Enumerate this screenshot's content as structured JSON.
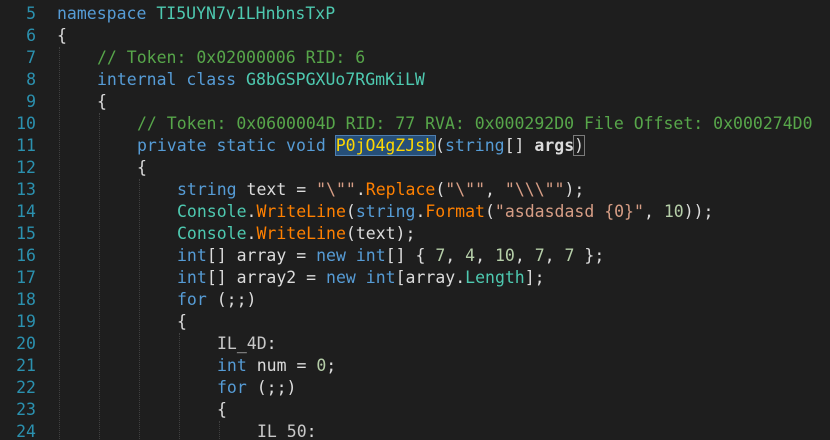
{
  "editor": {
    "lines": [
      {
        "n": "5",
        "indent": 0,
        "tokens": [
          {
            "t": "namespace ",
            "c": "kw"
          },
          {
            "t": "TI5UYN7v1LHnbnsTxP",
            "c": "ty"
          }
        ]
      },
      {
        "n": "6",
        "indent": 0,
        "tokens": [
          {
            "t": "{",
            "c": "ident"
          }
        ]
      },
      {
        "n": "7",
        "indent": 1,
        "tokens": [
          {
            "t": "// Token: 0x02000006 RID: 6",
            "c": "cm"
          }
        ]
      },
      {
        "n": "8",
        "indent": 1,
        "tokens": [
          {
            "t": "internal ",
            "c": "kw"
          },
          {
            "t": "class ",
            "c": "kw"
          },
          {
            "t": "G8bGSPGXUo7RGmKiLW",
            "c": "ty"
          }
        ]
      },
      {
        "n": "9",
        "indent": 1,
        "tokens": [
          {
            "t": "{",
            "c": "ident"
          }
        ]
      },
      {
        "n": "10",
        "indent": 2,
        "tokens": [
          {
            "t": "// Token: 0x0600004D RID: 77 RVA: 0x000292D0 File Offset: 0x000274D0",
            "c": "cm"
          }
        ]
      },
      {
        "n": "11",
        "indent": 2,
        "tokens": [
          {
            "t": "private ",
            "c": "kw"
          },
          {
            "t": "static ",
            "c": "kw"
          },
          {
            "t": "void ",
            "c": "kw"
          },
          {
            "t": "P0jO4gZJsb",
            "c": "hl"
          },
          {
            "t": "(",
            "c": "ident"
          },
          {
            "t": "string",
            "c": "kw"
          },
          {
            "t": "[] ",
            "c": "ident"
          },
          {
            "t": "args",
            "c": "prm"
          },
          {
            "t": ")",
            "c": "braceHL"
          }
        ]
      },
      {
        "n": "12",
        "indent": 2,
        "tokens": [
          {
            "t": "{",
            "c": "ident"
          }
        ]
      },
      {
        "n": "13",
        "indent": 3,
        "tokens": [
          {
            "t": "string ",
            "c": "kw"
          },
          {
            "t": "text = ",
            "c": "ident"
          },
          {
            "t": "\"\\\"\"",
            "c": "str"
          },
          {
            "t": ".",
            "c": "ident"
          },
          {
            "t": "Replace",
            "c": "mth"
          },
          {
            "t": "(",
            "c": "ident"
          },
          {
            "t": "\"\\\"\"",
            "c": "str"
          },
          {
            "t": ", ",
            "c": "ident"
          },
          {
            "t": "\"\\\\\\\"\"",
            "c": "str"
          },
          {
            "t": ");",
            "c": "ident"
          }
        ]
      },
      {
        "n": "14",
        "indent": 3,
        "tokens": [
          {
            "t": "Console",
            "c": "ty"
          },
          {
            "t": ".",
            "c": "ident"
          },
          {
            "t": "WriteLine",
            "c": "mth"
          },
          {
            "t": "(",
            "c": "ident"
          },
          {
            "t": "string",
            "c": "kw"
          },
          {
            "t": ".",
            "c": "ident"
          },
          {
            "t": "Format",
            "c": "mth"
          },
          {
            "t": "(",
            "c": "ident"
          },
          {
            "t": "\"asdasdasd {0}\"",
            "c": "str"
          },
          {
            "t": ", ",
            "c": "ident"
          },
          {
            "t": "10",
            "c": "num"
          },
          {
            "t": "));",
            "c": "ident"
          }
        ]
      },
      {
        "n": "15",
        "indent": 3,
        "tokens": [
          {
            "t": "Console",
            "c": "ty"
          },
          {
            "t": ".",
            "c": "ident"
          },
          {
            "t": "WriteLine",
            "c": "mth"
          },
          {
            "t": "(text);",
            "c": "ident"
          }
        ]
      },
      {
        "n": "16",
        "indent": 3,
        "tokens": [
          {
            "t": "int",
            "c": "kw"
          },
          {
            "t": "[] array = ",
            "c": "ident"
          },
          {
            "t": "new ",
            "c": "kw"
          },
          {
            "t": "int",
            "c": "kw"
          },
          {
            "t": "[] { ",
            "c": "ident"
          },
          {
            "t": "7",
            "c": "num"
          },
          {
            "t": ", ",
            "c": "ident"
          },
          {
            "t": "4",
            "c": "num"
          },
          {
            "t": ", ",
            "c": "ident"
          },
          {
            "t": "10",
            "c": "num"
          },
          {
            "t": ", ",
            "c": "ident"
          },
          {
            "t": "7",
            "c": "num"
          },
          {
            "t": ", ",
            "c": "ident"
          },
          {
            "t": "7",
            "c": "num"
          },
          {
            "t": " };",
            "c": "ident"
          }
        ]
      },
      {
        "n": "17",
        "indent": 3,
        "tokens": [
          {
            "t": "int",
            "c": "kw"
          },
          {
            "t": "[] array2 = ",
            "c": "ident"
          },
          {
            "t": "new ",
            "c": "kw"
          },
          {
            "t": "int",
            "c": "kw"
          },
          {
            "t": "[array.",
            "c": "ident"
          },
          {
            "t": "Length",
            "c": "ty"
          },
          {
            "t": "];",
            "c": "ident"
          }
        ]
      },
      {
        "n": "18",
        "indent": 3,
        "tokens": [
          {
            "t": "for ",
            "c": "kw"
          },
          {
            "t": "(;;)",
            "c": "ident"
          }
        ]
      },
      {
        "n": "19",
        "indent": 3,
        "tokens": [
          {
            "t": "{",
            "c": "ident"
          }
        ]
      },
      {
        "n": "20",
        "indent": 4,
        "tokens": [
          {
            "t": "IL_4D",
            "c": "lbl"
          },
          {
            "t": ":",
            "c": "ident"
          }
        ]
      },
      {
        "n": "21",
        "indent": 4,
        "tokens": [
          {
            "t": "int ",
            "c": "kw"
          },
          {
            "t": "num = ",
            "c": "ident"
          },
          {
            "t": "0",
            "c": "num"
          },
          {
            "t": ";",
            "c": "ident"
          }
        ]
      },
      {
        "n": "22",
        "indent": 4,
        "tokens": [
          {
            "t": "for ",
            "c": "kw"
          },
          {
            "t": "(;;)",
            "c": "ident"
          }
        ]
      },
      {
        "n": "23",
        "indent": 4,
        "tokens": [
          {
            "t": "{",
            "c": "ident"
          }
        ]
      },
      {
        "n": "24",
        "indent": 5,
        "tokens": [
          {
            "t": "IL_50",
            "c": "lbl"
          },
          {
            "t": ":",
            "c": "ident"
          }
        ]
      }
    ]
  },
  "colors": {
    "background": "#1e1e1e",
    "line_number": "#2b91af",
    "keyword": "#569cd6",
    "type": "#4ec9b0",
    "string": "#d69d85",
    "comment": "#57a64a",
    "method": "#ff8000",
    "number": "#b5cea8"
  }
}
